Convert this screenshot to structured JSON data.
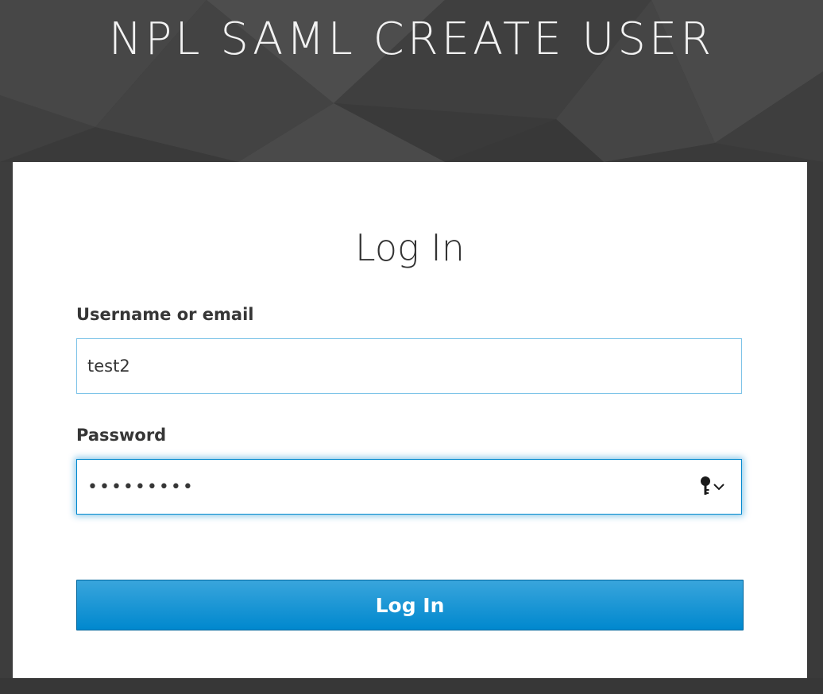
{
  "header": {
    "realm_title": "NPL SAML CREATE USER"
  },
  "login": {
    "title": "Log In",
    "username_label": "Username or email",
    "username_value": "test2",
    "password_label": "Password",
    "password_value": "123456789",
    "submit_label": "Log In"
  },
  "icons": {
    "password_manager": "key-icon",
    "dropdown": "chevron-down-icon"
  },
  "colors": {
    "background": "#3b3b3b",
    "card": "#ffffff",
    "accent": "#0088ce",
    "button_top": "#39a5dc",
    "input_border": "#7dc3e8"
  }
}
